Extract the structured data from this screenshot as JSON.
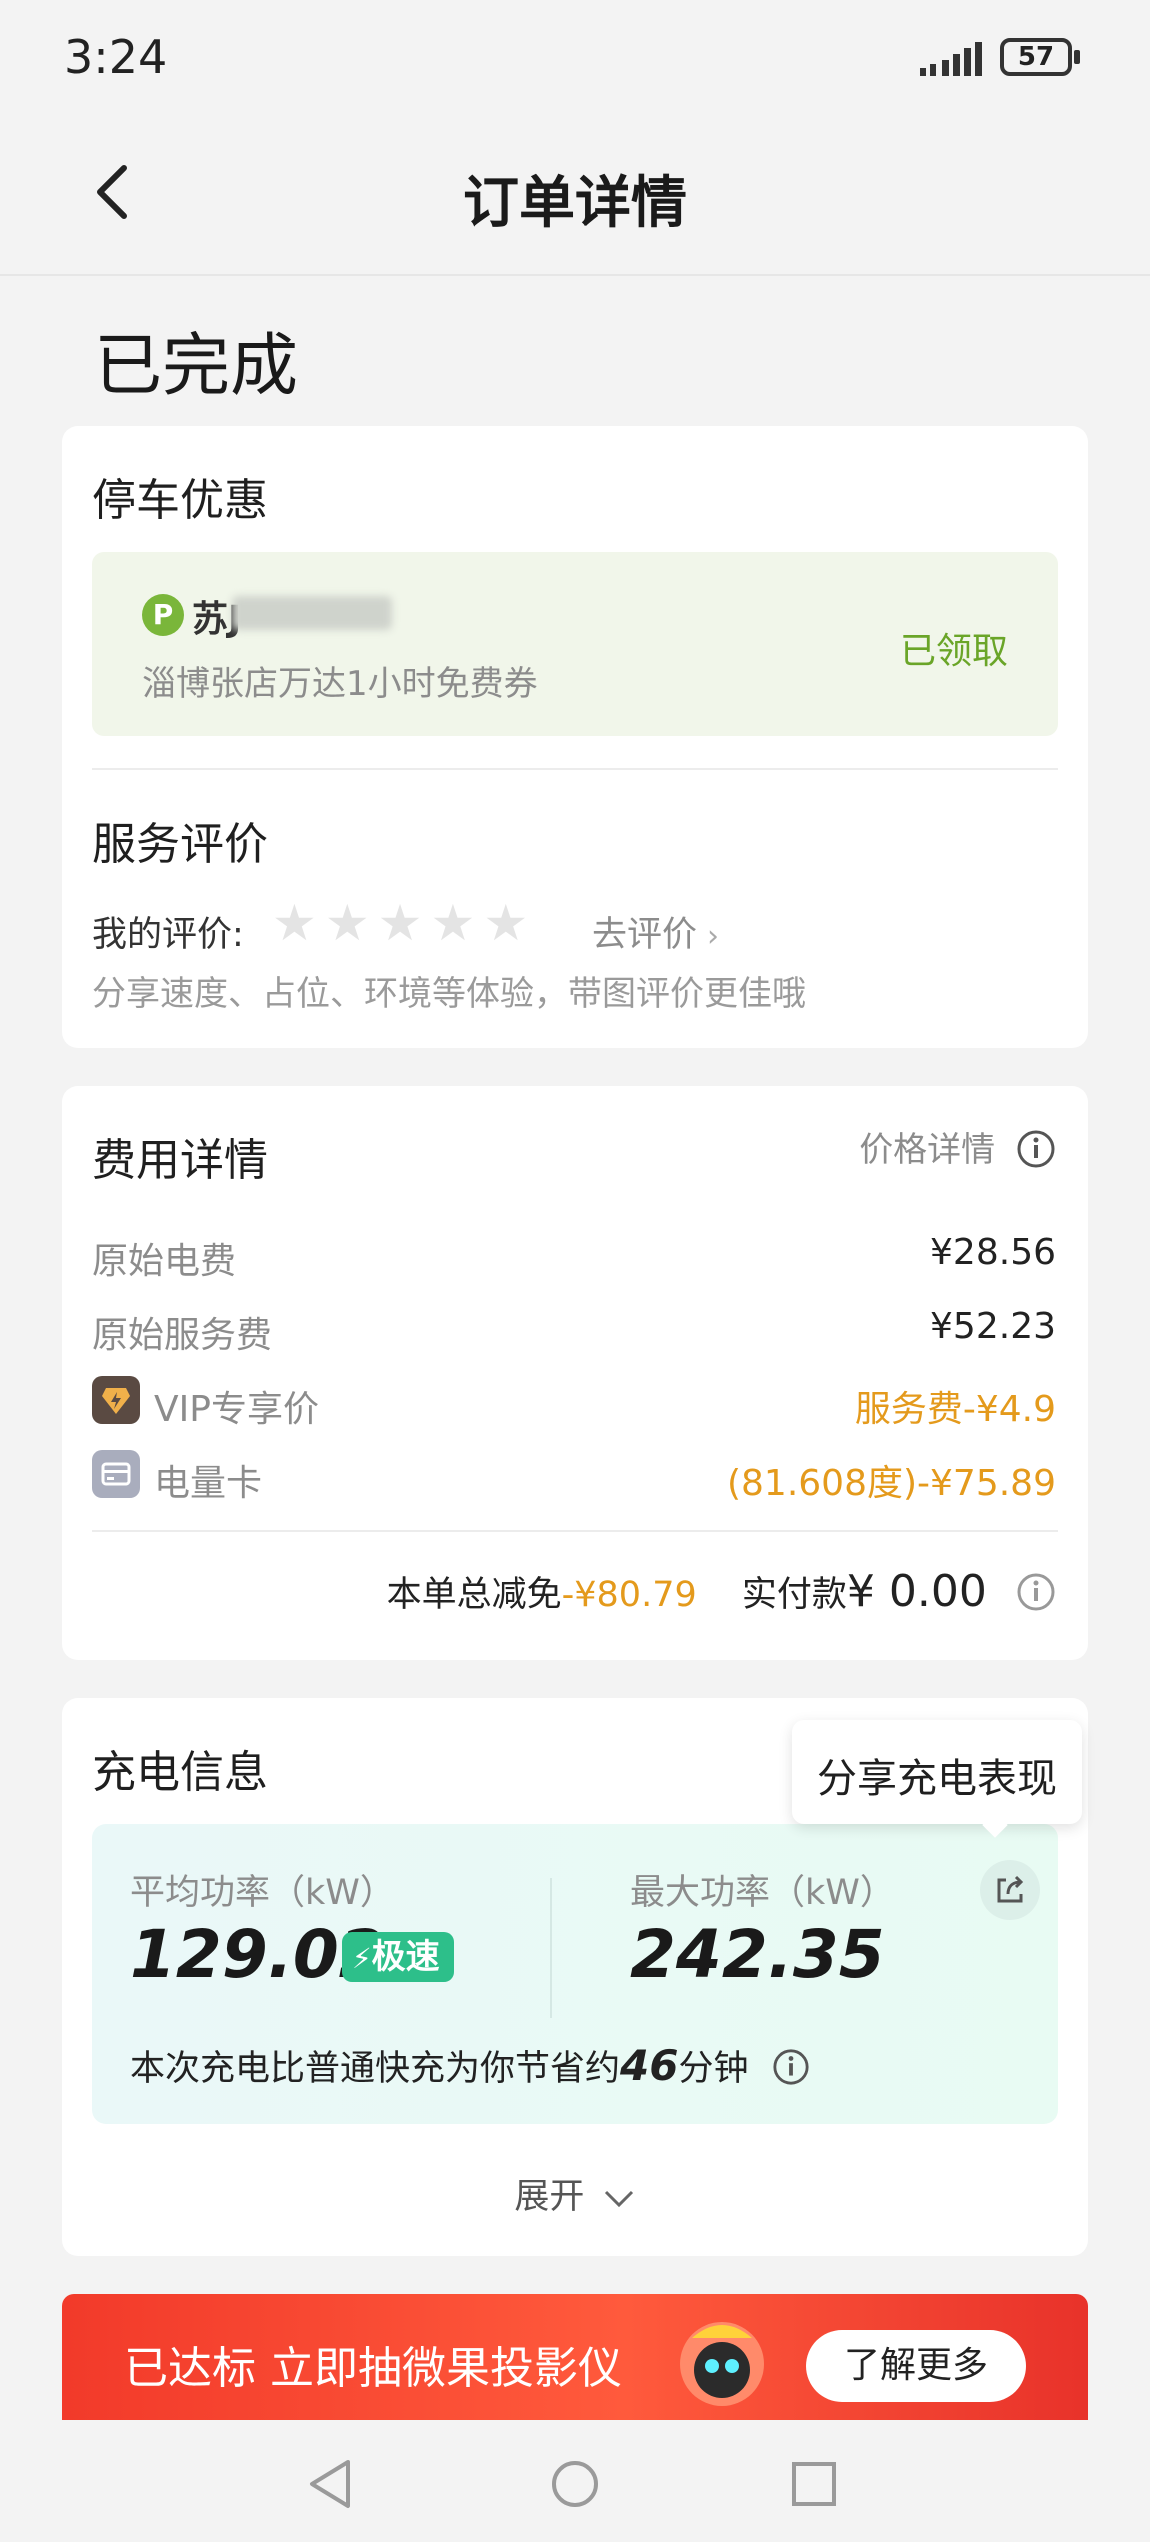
{
  "status_bar": {
    "time": "3:24",
    "battery": "57"
  },
  "nav": {
    "title": "订单详情"
  },
  "order_status": "已完成",
  "parking": {
    "title": "停车优惠",
    "coupon_name": "苏J",
    "coupon_desc": "淄博张店万达1小时免费券",
    "coupon_status": "已领取",
    "coupon_icon_letter": "P"
  },
  "review": {
    "title": "服务评价",
    "my_rating_label": "我的评价:",
    "go_review": "去评价",
    "hint": "分享速度、占位、环境等体验，带图评价更佳哦",
    "stars": 0
  },
  "fees": {
    "title": "费用详情",
    "price_detail": "价格详情",
    "rows": [
      {
        "label": "原始电费",
        "value": "¥28.56"
      },
      {
        "label": "原始服务费",
        "value": "¥52.23"
      },
      {
        "label": "VIP专享价",
        "value": "服务费-¥4.9"
      },
      {
        "label": "电量卡",
        "value": "(81.608度)-¥75.89"
      }
    ],
    "total_discount_label": "本单总减免",
    "total_discount_value": "-¥80.79",
    "paid_label": "实付款",
    "paid_value": "¥ 0.00"
  },
  "charging": {
    "title": "充电信息",
    "share_tooltip": "分享充电表现",
    "avg_power_label": "平均功率（kW）",
    "avg_power_value": "129.02",
    "speed_badge": "极速",
    "max_power_label": "最大功率（kW）",
    "max_power_value": "242.35",
    "saving_prefix": "本次充电比普通快充为你节省约",
    "saving_minutes": "46",
    "saving_suffix": "分钟",
    "expand": "展开"
  },
  "banner": {
    "text": "已达标 立即抽微果投影仪",
    "button": "了解更多"
  },
  "colors": {
    "green": "#6aa528",
    "orange": "#e49a1c",
    "teal": "#2dbf8a",
    "banner_red": "#f23a2a"
  }
}
